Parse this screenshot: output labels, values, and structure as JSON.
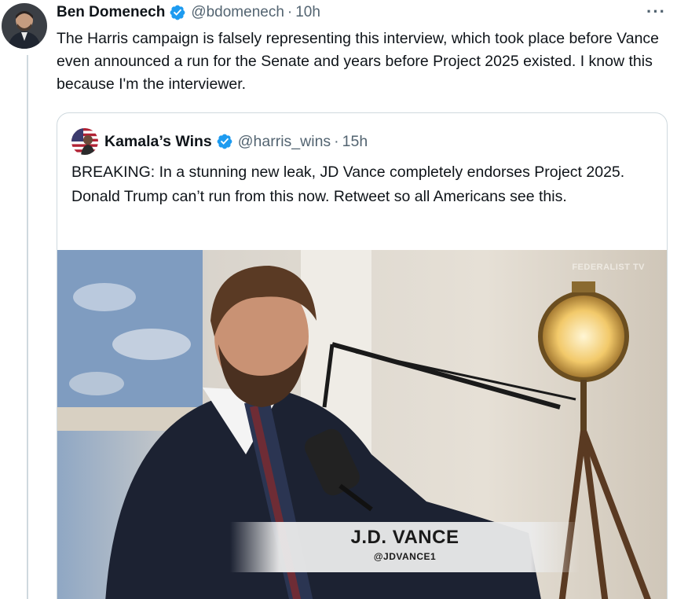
{
  "tweet": {
    "author_name": "Ben Domenech",
    "handle": "@bdomenech",
    "separator": "·",
    "time": "10h",
    "more_label": "···",
    "text": "The Harris campaign is falsely representing this interview, which took place before Vance even announced a run for the Senate and years before Project 2025 existed. I know this because I'm the interviewer."
  },
  "quoted_tweet": {
    "author_name": "Kamala’s Wins",
    "handle": "@harris_wins",
    "separator": "·",
    "time": "15h",
    "text": "BREAKING: In a stunning new leak, JD Vance completely endorses Project 2025. Donald Trump can’t run from this now. Retweet so all Americans see this."
  },
  "media": {
    "watermark": "FEDERALIST TV",
    "lower_third_name": "J.D. VANCE",
    "lower_third_handle": "@JDVANCE1"
  },
  "colors": {
    "verified_blue": "#1d9bf0",
    "secondary_text": "#536471",
    "border": "#cfd9de"
  },
  "icons": {
    "verified": "verified-badge-icon",
    "more": "more-dots-icon"
  }
}
